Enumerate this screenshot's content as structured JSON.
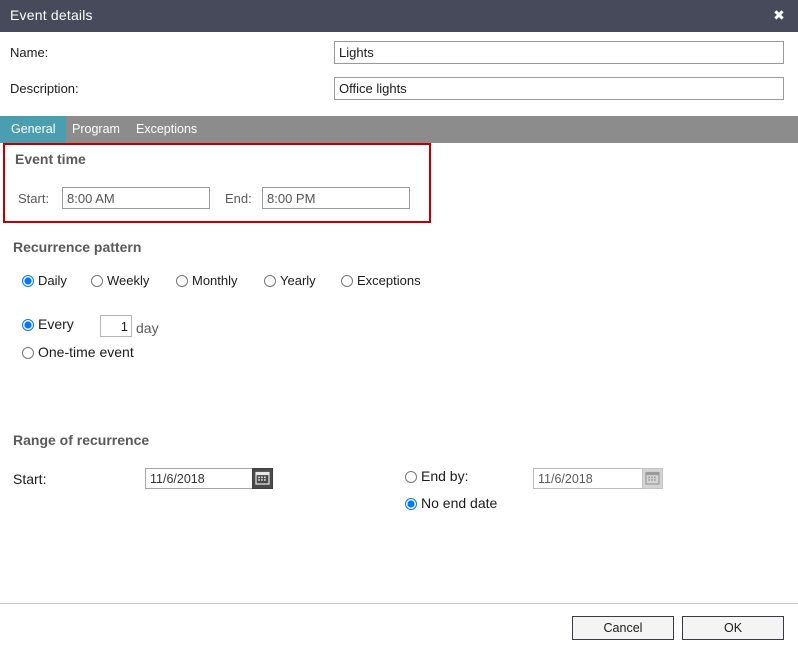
{
  "window": {
    "title": "Event details",
    "close_icon": "close-icon",
    "close_glyph": "✖",
    "titlebar_color": "#464a5a"
  },
  "header": {
    "name_label": "Name:",
    "name_value": "Lights",
    "description_label": "Description:",
    "description_value": "Office lights"
  },
  "tabs": {
    "active": "General",
    "active_color": "#4b9eb0",
    "bar_color": "#8c8c8c",
    "items": [
      {
        "label": "General"
      },
      {
        "label": "Program"
      },
      {
        "label": "Exceptions"
      }
    ]
  },
  "event_time": {
    "section_title": "Event time",
    "highlight_color": "#c00000",
    "start_label": "Start:",
    "start_value": "8:00 AM",
    "end_label": "End:",
    "end_value": "8:00 PM"
  },
  "recurrence_pattern": {
    "section_title": "Recurrence pattern",
    "options": [
      {
        "label": "Daily",
        "selected": true
      },
      {
        "label": "Weekly",
        "selected": false
      },
      {
        "label": "Monthly",
        "selected": false
      },
      {
        "label": "Yearly",
        "selected": false
      },
      {
        "label": "Exceptions",
        "selected": false
      }
    ],
    "every_label": "Every",
    "every_selected": true,
    "every_value": "1",
    "every_unit": "day",
    "onetime_label": "One-time event",
    "onetime_selected": false
  },
  "range_of_recurrence": {
    "section_title": "Range of recurrence",
    "start_label": "Start:",
    "start_value": "11/6/2018",
    "start_calendar_icon": "calendar-icon",
    "end_by_label": "End by:",
    "end_by_selected": false,
    "end_by_value": "11/6/2018",
    "end_by_calendar_icon": "calendar-icon",
    "end_by_calendar_disabled": true,
    "no_end_date_label": "No end date",
    "no_end_date_selected": true
  },
  "footer": {
    "cancel_label": "Cancel",
    "ok_label": "OK"
  }
}
